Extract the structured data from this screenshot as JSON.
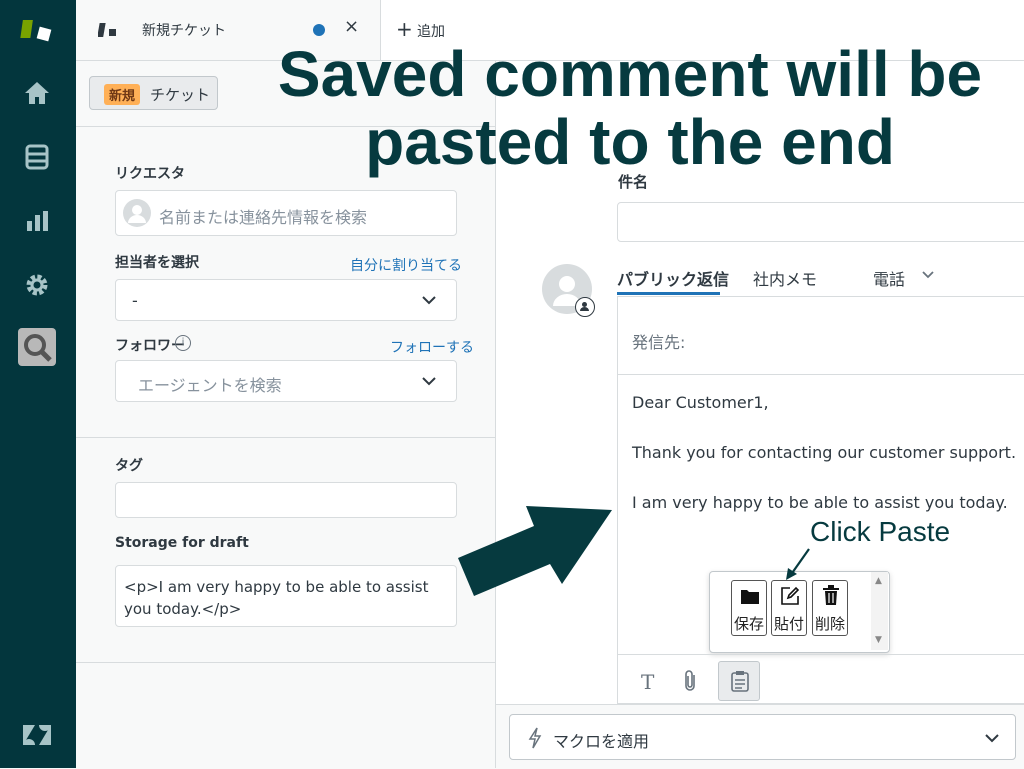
{
  "topbar": {
    "tab_title": "新規チケット",
    "add_label": "追加"
  },
  "ticket_badge": {
    "status": "新規",
    "type": "チケット"
  },
  "left_panel": {
    "requester_label": "リクエスタ",
    "requester_placeholder": "名前または連絡先情報を検索",
    "assignee_label": "担当者を選択",
    "assign_self_link": "自分に割り当てる",
    "assignee_value": "-",
    "followers_label": "フォロワー",
    "follow_link": "フォローする",
    "followers_placeholder": "エージェントを検索",
    "tags_label": "タグ",
    "tags_value": "",
    "draft_label": "Storage for draft",
    "draft_value": "<p>I am very happy to be able to assist you today.</p>"
  },
  "right_panel": {
    "subject_label": "件名",
    "subject_value": "",
    "tabs": [
      "パブリック返信",
      "社内メモ",
      "電話"
    ],
    "to_label": "発信先:",
    "body_lines": [
      "Dear Customer1,",
      "Thank you for contacting our customer support.",
      "I am very happy to be able to assist you today."
    ],
    "popup": {
      "save": "保存",
      "paste": "貼付",
      "delete": "削除"
    },
    "macro_label": "マクロを適用"
  },
  "annotations": {
    "headline_line1": "Saved comment will be",
    "headline_line2": "pasted to the end",
    "click_paste": "Click Paste"
  },
  "colors": {
    "nav_bg": "#03363d",
    "accent": "#1f73b7",
    "badge": "#ffb057",
    "annotation": "#063a3f",
    "logo_green": "#78a300"
  }
}
